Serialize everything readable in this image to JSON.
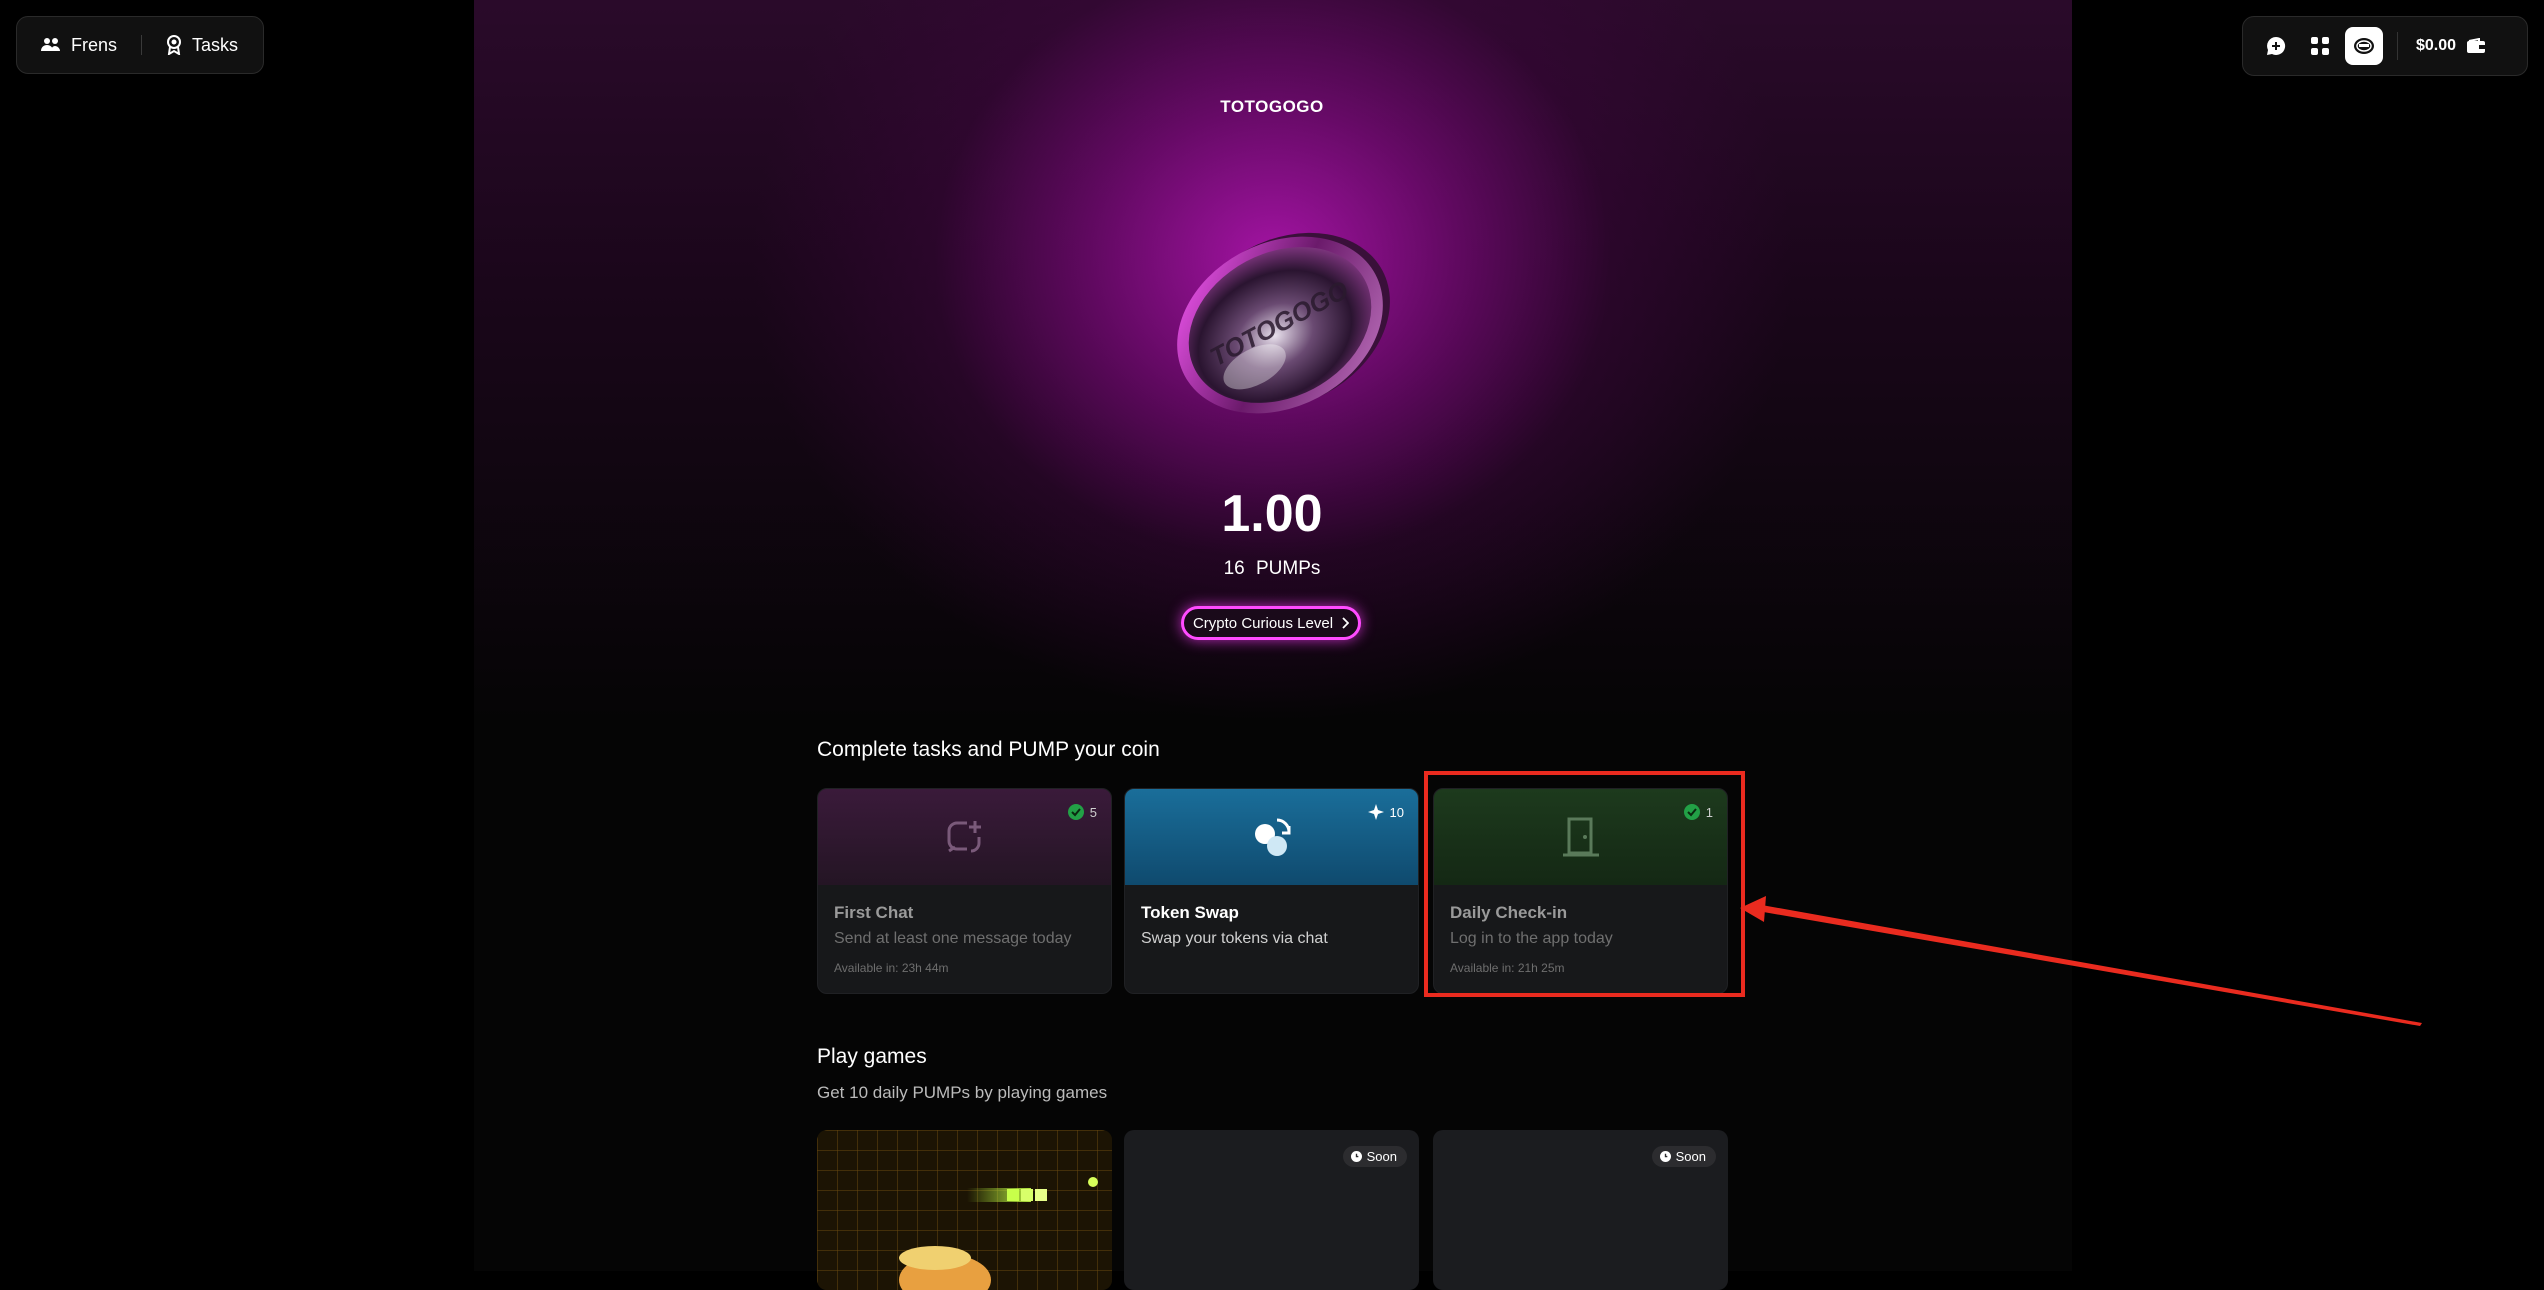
{
  "nav": {
    "frens_label": "Frens",
    "tasks_label": "Tasks"
  },
  "toolbar": {
    "balance": "$0.00"
  },
  "hero": {
    "coin_name": "TOTOGOGO",
    "coin_text": "TOTOGOGO",
    "value": "1.00",
    "pumps_count": "16",
    "pumps_unit": "PUMPs",
    "level_label": "Crypto Curious Level"
  },
  "tasks": {
    "title": "Complete tasks and PUMP your coin",
    "cards": [
      {
        "title": "First Chat",
        "desc": "Send at least one message today",
        "avail": "Available in: 23h 44m",
        "badge": "5"
      },
      {
        "title": "Token Swap",
        "desc": "Swap your tokens via chat",
        "avail": "",
        "badge": "10"
      },
      {
        "title": "Daily Check-in",
        "desc": "Log in to the app today",
        "avail": "Available in: 21h 25m",
        "badge": "1"
      }
    ]
  },
  "games": {
    "title": "Play games",
    "subtitle": "Get 10 daily PUMPs by playing games",
    "soon_label": "Soon"
  },
  "colors": {
    "accent": "#ff4bff",
    "highlight": "#ea2b1f",
    "check": "#22a046"
  }
}
